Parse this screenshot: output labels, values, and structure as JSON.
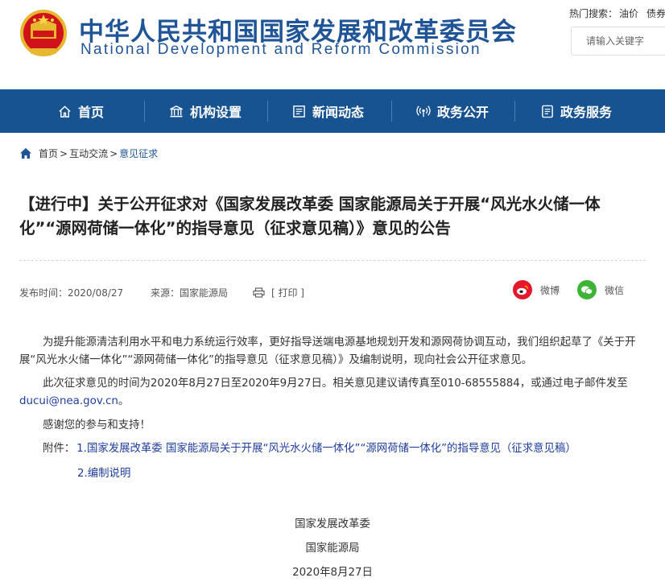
{
  "header": {
    "logo_cn": "中华人民共和国国家发展和改革委员会",
    "logo_en": "National Development and Reform Commission",
    "hot_label": "热门搜索：",
    "hot_terms": [
      "油价",
      "债券"
    ],
    "search_placeholder": "请输入关键字"
  },
  "nav": {
    "items": [
      {
        "label": "首页",
        "icon": "home-icon"
      },
      {
        "label": "机构设置",
        "icon": "building-icon"
      },
      {
        "label": "新闻动态",
        "icon": "newspaper-icon"
      },
      {
        "label": "政务公开",
        "icon": "broadcast-icon"
      },
      {
        "label": "政务服务",
        "icon": "document-icon"
      }
    ]
  },
  "breadcrumb": {
    "items": [
      "首页",
      "互动交流",
      "意见征求"
    ],
    "separator": ">"
  },
  "article": {
    "title": "【进行中】关于公开征求对《国家发展改革委 国家能源局关于开展“风光水火储一体化”“源网荷储一体化”的指导意见（征求意见稿）》意见的公告",
    "publish_time": "发布时间：2020/08/27",
    "source": "来源：国家能源局",
    "print": "[ 打印 ]",
    "share_weibo": "微博",
    "share_wechat": "微信",
    "para1": "为提升能源清洁利用水平和电力系统运行效率，更好指导送端电源基地规划开发和源网荷协调互动，我们组织起草了《关于开展“风光水火储一体化”“源网荷储一体化”的指导意见（征求意见稿）》及编制说明，现向社会公开征求意见。",
    "para2_before": "此次征求意见的时间为2020年8月27日至2020年9月27日。相关意见建议请传真至010-68555884，或通过电子邮件发至",
    "email": "ducui@nea.gov.cn",
    "para2_after": "。",
    "para3": "感谢您的参与和支持！",
    "attach_label": "附件：",
    "attachment1": "1.国家发展改革委 国家能源局关于开展“风光水火储一体化”“源网荷储一体化”的指导意见（征求意见稿）",
    "attachment2": "2.编制说明",
    "sign1": "国家发展改革委",
    "sign2": "国家能源局",
    "sign_date": "2020年8月27日"
  },
  "colors": {
    "brand_blue": "#1f5597",
    "nav_bg": "#175390",
    "link_blue": "#1f3d9c",
    "weibo_red": "#e6162d",
    "wechat_green": "#3fb336"
  }
}
